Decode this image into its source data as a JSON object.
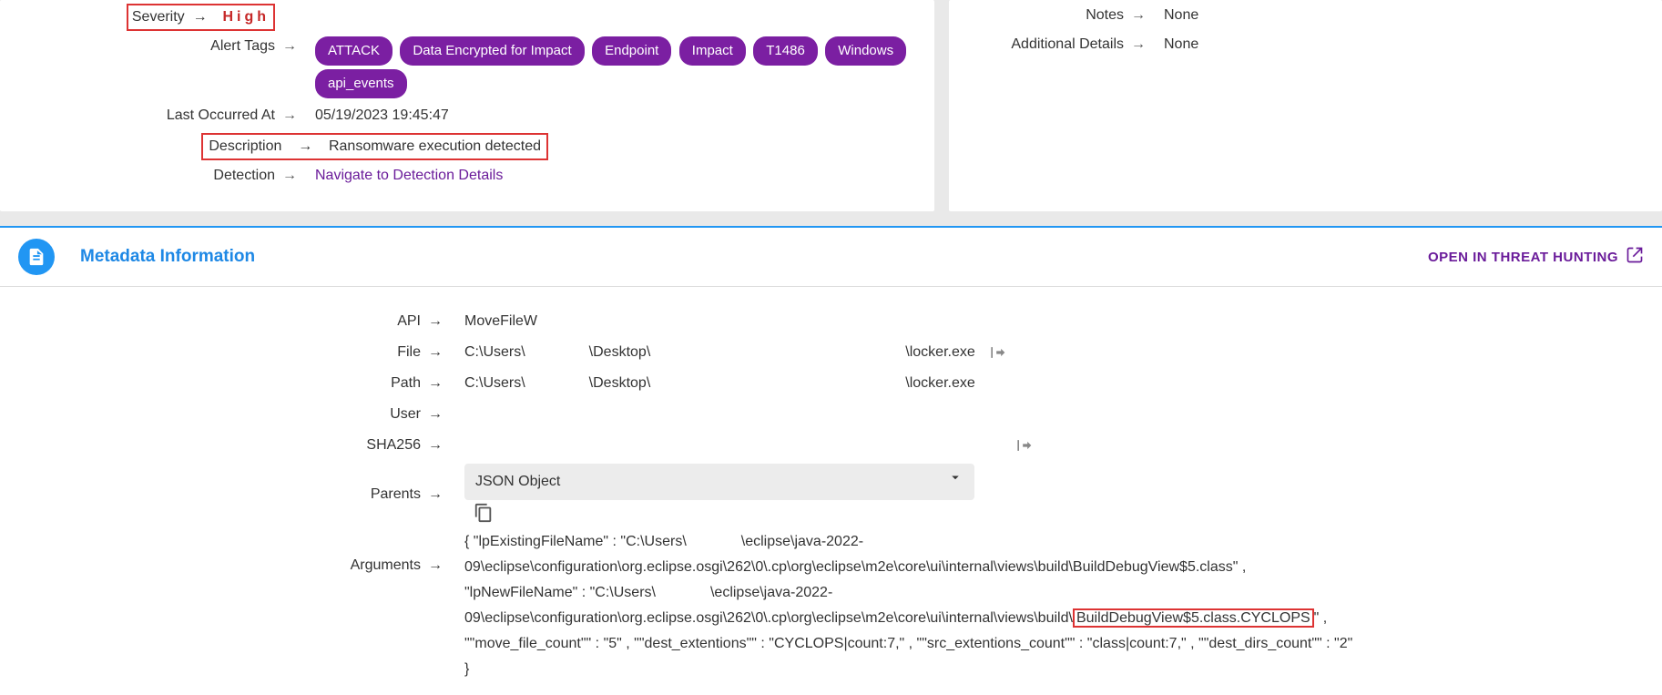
{
  "alert": {
    "severity_label": "Severity",
    "severity_value": "High",
    "tags_label": "Alert Tags",
    "tags": [
      "ATTACK",
      "Data Encrypted for Impact",
      "Endpoint",
      "Impact",
      "T1486",
      "Windows",
      "api_events"
    ],
    "last_occurred_label": "Last Occurred At",
    "last_occurred_value": "05/19/2023 19:45:47",
    "description_label": "Description",
    "description_value": "Ransomware execution detected",
    "detection_label": "Detection",
    "detection_link": "Navigate to Detection Details"
  },
  "side": {
    "notes_label": "Notes",
    "notes_value": "None",
    "additional_label": "Additional Details",
    "additional_value": "None"
  },
  "section": {
    "title": "Metadata Information",
    "open_link": "OPEN IN THREAT HUNTING"
  },
  "meta": {
    "api_label": "API",
    "api_value": "MoveFileW",
    "file_label": "File",
    "file_p1": "C:\\Users\\",
    "file_p2": "\\Desktop\\",
    "file_p3": "\\locker.exe",
    "path_label": "Path",
    "path_p1": "C:\\Users\\",
    "path_p2": "\\Desktop\\",
    "path_p3": "\\locker.exe",
    "user_label": "User",
    "sha_label": "SHA256",
    "parents_label": "Parents",
    "parents_dropdown": "JSON Object",
    "arguments_label": "Arguments",
    "args_p1": "{ \"lpExistingFileName\" : \"C:\\Users\\",
    "args_p2": "\\eclipse\\java-2022-09\\eclipse\\configuration\\org.eclipse.osgi\\262\\0\\.cp\\org\\eclipse\\m2e\\core\\ui\\internal\\views\\build\\BuildDebugView$5.class\" , \"lpNewFileName\" : \"C:\\Users\\",
    "args_p3": "\\eclipse\\java-2022-09\\eclipse\\configuration\\org.eclipse.osgi\\262\\0\\.cp\\org\\eclipse\\m2e\\core\\ui\\internal\\views\\build\\",
    "args_highlight": "BuildDebugView$5.class.CYCLOPS",
    "args_p4": "\" , \"\"move_file_count\"\" : \"5\" , \"\"dest_extentions\"\" : \"CYCLOPS|count:7,\" , \"\"src_extentions_count\"\" : \"class|count:7,\" , \"\"dest_dirs_count\"\" : \"2\" }"
  },
  "arrow": "→"
}
